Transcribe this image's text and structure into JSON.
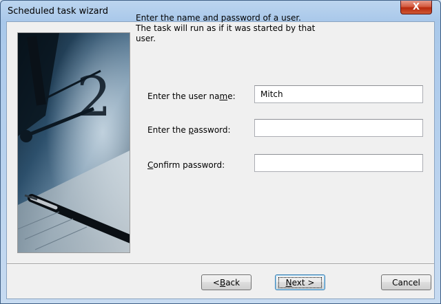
{
  "window": {
    "title": "Scheduled task wizard"
  },
  "titlebar": {
    "close_glyph": "X"
  },
  "intro": {
    "line1": "Enter the name and password of a user.",
    "line2": "The task will run as if it was started by that",
    "line3": "user."
  },
  "form": {
    "username": {
      "label_pre": "Enter the user na",
      "label_key": "m",
      "label_post": "e:",
      "value": "Mitch"
    },
    "password": {
      "label_pre": "Enter the ",
      "label_key": "p",
      "label_post": "assword:",
      "value": ""
    },
    "confirm": {
      "label_pre": "",
      "label_key": "C",
      "label_post": "onfirm password:",
      "value": ""
    }
  },
  "buttons": {
    "back": {
      "pre": "< ",
      "key": "B",
      "post": "ack"
    },
    "next": {
      "pre": "",
      "key": "N",
      "post": "ext >"
    },
    "cancel": {
      "label": "Cancel"
    }
  }
}
